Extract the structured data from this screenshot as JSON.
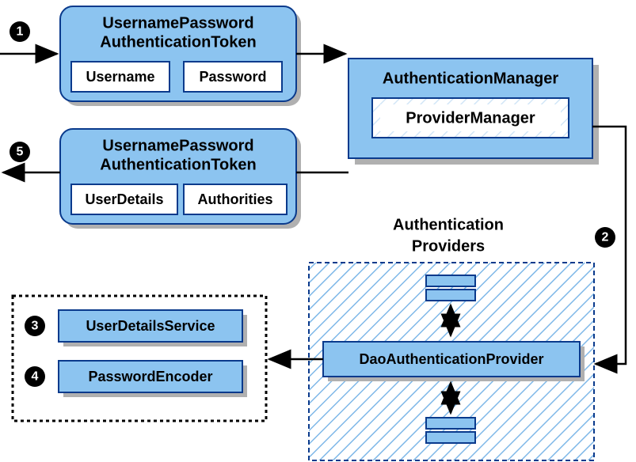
{
  "diagram": {
    "token_in": {
      "title_line1": "UsernamePassword",
      "title_line2": "AuthenticationToken",
      "field1": "Username",
      "field2": "Password"
    },
    "token_out": {
      "title_line1": "UsernamePassword",
      "title_line2": "AuthenticationToken",
      "field1": "UserDetails",
      "field2": "Authorities"
    },
    "manager": {
      "title": "AuthenticationManager",
      "impl": "ProviderManager"
    },
    "providers": {
      "title_line1": "Authentication",
      "title_line2": "Providers",
      "dao": "DaoAuthenticationProvider"
    },
    "services": {
      "user_details": "UserDetailsService",
      "password_encoder": "PasswordEncoder"
    },
    "steps": {
      "s1": "1",
      "s2": "2",
      "s3": "3",
      "s4": "4",
      "s5": "5"
    }
  }
}
